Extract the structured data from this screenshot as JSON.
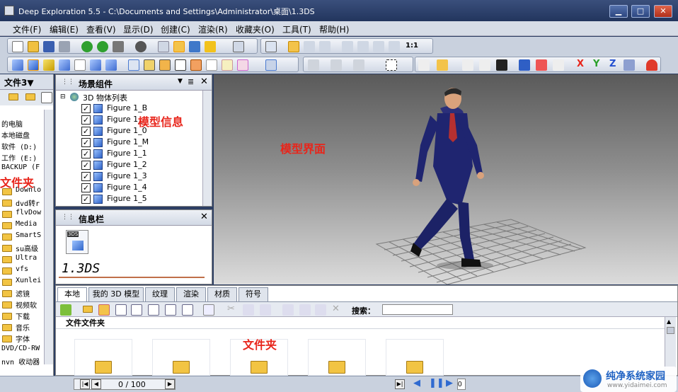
{
  "window": {
    "title": "Deep Exploration 5.5 - C:\\Documents and Settings\\Administrator\\桌面\\1.3DS",
    "minimize_label": "▁",
    "maximize_label": "□",
    "close_label": "✕"
  },
  "menu": [
    "文件(F)",
    "编辑(E)",
    "查看(V)",
    "显示(D)",
    "创建(C)",
    "渲染(R)",
    "收藏夹(O)",
    "工具(T)",
    "帮助(H)"
  ],
  "toolbar2": {
    "zoom_label": "1:1"
  },
  "axes": {
    "x": "X",
    "y": "Y",
    "z": "Z"
  },
  "left_panel": {
    "title": "文件3▼",
    "rows": [
      "的电脑",
      "本地磁盘",
      "软件 (D:)",
      "工作 (E:)",
      "BACKUP (F"
    ],
    "folders": [
      "Downlo",
      "dvd转r",
      "flvDow",
      "Media",
      "SmartS",
      "su高级",
      "Ultra",
      "vfs",
      "Xunlei",
      "滤镜",
      "视频软",
      "下载",
      "音乐",
      "字体"
    ],
    "bottom_rows": [
      "DVD/CD-RW",
      "nvn 收动器"
    ],
    "overlay_label": "文件夹"
  },
  "scene_panel": {
    "title": "场景组件",
    "root": "3D 物体列表",
    "items": [
      "Figure 1_B",
      "Figure 1_",
      "Figure 1_0",
      "Figure 1_M",
      "Figure 1_1",
      "Figure 1_2",
      "Figure 1_3",
      "Figure 1_4",
      "Figure 1_5"
    ],
    "overlay_label": "模型信息"
  },
  "info_panel": {
    "title": "信息栏",
    "file_icon_label": "3DS",
    "filename": "1.3DS"
  },
  "viewport": {
    "overlay_label": "模型界面"
  },
  "browser": {
    "tabs": [
      "本地",
      "我的 3D 模型",
      "纹理",
      "渲染",
      "材质",
      "符号"
    ],
    "active_tab": 0,
    "search_label": "搜索：",
    "search_value": "",
    "folder_header": "文件文件夹",
    "overlay_label": "文件夹",
    "thumb_count": 5
  },
  "status": {
    "page": "0 / 100",
    "field_value": "0"
  },
  "watermark": {
    "title": "纯净系统家园",
    "url": "www.yidaimei.com"
  },
  "colors": {
    "accent_red": "#e8251b",
    "title_bar": "#22355d",
    "toolbar": "#c9d1de"
  }
}
